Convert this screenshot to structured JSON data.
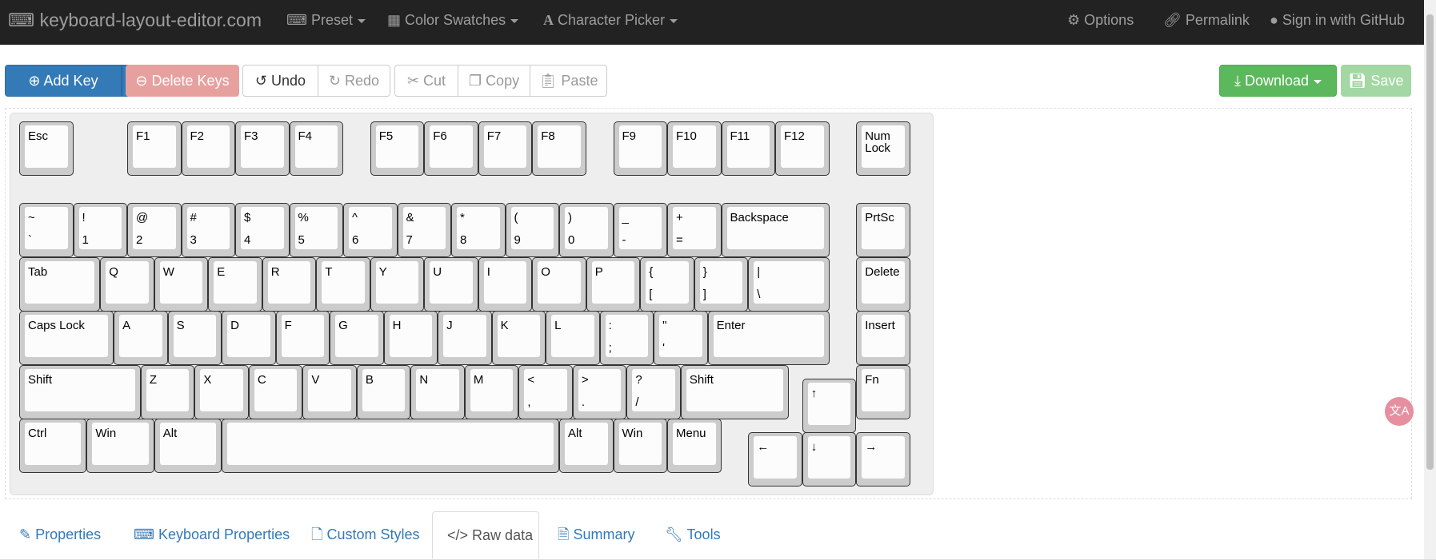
{
  "navbar": {
    "brand": "keyboard-layout-editor.com",
    "menu": [
      {
        "label": "Preset",
        "icon": "keyboard-icon"
      },
      {
        "label": "Color Swatches",
        "icon": "grid-icon"
      },
      {
        "label": "Character Picker",
        "icon": "font-icon"
      }
    ],
    "right": [
      {
        "label": "Options",
        "icon": "gear-icon"
      },
      {
        "label": "Permalink",
        "icon": "link-icon"
      },
      {
        "label": "Sign in with GitHub",
        "icon": "github-icon"
      }
    ]
  },
  "toolbar": {
    "add_key": "Add Key",
    "delete_keys": "Delete Keys",
    "undo": "Undo",
    "redo": "Redo",
    "cut": "Cut",
    "copy": "Copy",
    "paste": "Paste",
    "download": "Download",
    "save": "Save"
  },
  "keys": [
    {
      "t": "Esc"
    },
    {
      "t": "F1"
    },
    {
      "t": "F2"
    },
    {
      "t": "F3"
    },
    {
      "t": "F4"
    },
    {
      "t": "F5"
    },
    {
      "t": "F6"
    },
    {
      "t": "F7"
    },
    {
      "t": "F8"
    },
    {
      "t": "F9"
    },
    {
      "t": "F10"
    },
    {
      "t": "F11"
    },
    {
      "t": "F12"
    },
    {
      "t": "Num\nLock"
    },
    {
      "t": "~",
      "b": "`"
    },
    {
      "t": "!",
      "b": "1"
    },
    {
      "t": "@",
      "b": "2"
    },
    {
      "t": "#",
      "b": "3"
    },
    {
      "t": "$",
      "b": "4"
    },
    {
      "t": "%",
      "b": "5"
    },
    {
      "t": "^",
      "b": "6"
    },
    {
      "t": "&",
      "b": "7"
    },
    {
      "t": "*",
      "b": "8"
    },
    {
      "t": "(",
      "b": "9"
    },
    {
      "t": ")",
      "b": "0"
    },
    {
      "t": "_",
      "b": "-"
    },
    {
      "t": "+",
      "b": "="
    },
    {
      "t": "Backspace"
    },
    {
      "t": "PrtSc"
    },
    {
      "t": "Tab"
    },
    {
      "t": "Q"
    },
    {
      "t": "W"
    },
    {
      "t": "E"
    },
    {
      "t": "R"
    },
    {
      "t": "T"
    },
    {
      "t": "Y"
    },
    {
      "t": "U"
    },
    {
      "t": "I"
    },
    {
      "t": "O"
    },
    {
      "t": "P"
    },
    {
      "t": "{",
      "b": "["
    },
    {
      "t": "}",
      "b": "]"
    },
    {
      "t": "|",
      "b": "\\"
    },
    {
      "t": "Delete"
    },
    {
      "t": "Caps Lock"
    },
    {
      "t": "A"
    },
    {
      "t": "S"
    },
    {
      "t": "D"
    },
    {
      "t": "F"
    },
    {
      "t": "G"
    },
    {
      "t": "H"
    },
    {
      "t": "J"
    },
    {
      "t": "K"
    },
    {
      "t": "L"
    },
    {
      "t": ":",
      "b": ";"
    },
    {
      "t": "\"",
      "b": "'"
    },
    {
      "t": "Enter"
    },
    {
      "t": "Insert"
    },
    {
      "t": "Shift"
    },
    {
      "t": "Z"
    },
    {
      "t": "X"
    },
    {
      "t": "C"
    },
    {
      "t": "V"
    },
    {
      "t": "B"
    },
    {
      "t": "N"
    },
    {
      "t": "M"
    },
    {
      "t": "<",
      "b": ","
    },
    {
      "t": ">",
      "b": "."
    },
    {
      "t": "?",
      "b": "/"
    },
    {
      "t": "Shift"
    },
    {
      "t": "↑"
    },
    {
      "t": "Fn"
    },
    {
      "t": "Ctrl"
    },
    {
      "t": "Win"
    },
    {
      "t": "Alt"
    },
    {
      "t": ""
    },
    {
      "t": "Alt"
    },
    {
      "t": "Win"
    },
    {
      "t": "Menu"
    },
    {
      "t": "←"
    },
    {
      "t": "↓"
    },
    {
      "t": "→"
    }
  ],
  "tabs": [
    {
      "label": "Properties",
      "icon": "edit-icon"
    },
    {
      "label": "Keyboard Properties",
      "icon": "keyboard-icon"
    },
    {
      "label": "Custom Styles",
      "icon": "file-icon"
    },
    {
      "label": "Raw data",
      "icon": "code-icon",
      "active": true
    },
    {
      "label": "Summary",
      "icon": "list-icon"
    },
    {
      "label": "Tools",
      "icon": "wrench-icon"
    }
  ],
  "float_button": "文A",
  "colors": {
    "navbar": "#222222",
    "primary": "#337ab7",
    "danger": "#e6a19f",
    "success": "#5cb85c"
  }
}
